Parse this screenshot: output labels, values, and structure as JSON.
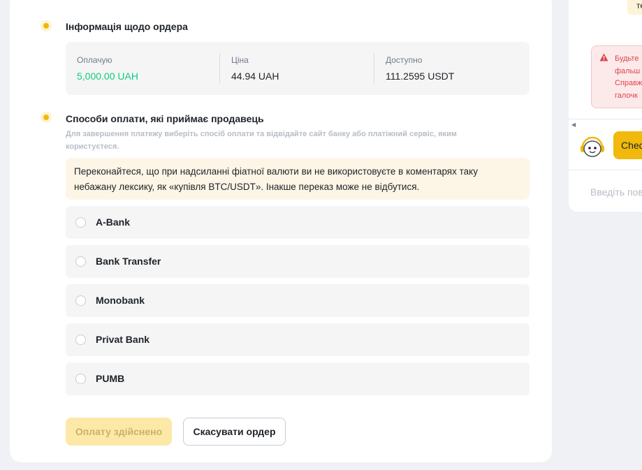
{
  "order_info": {
    "title": "Інформація щодо ордера",
    "items": [
      {
        "label": "Оплачую",
        "value": "5,000.00 UAH"
      },
      {
        "label": "Ціна",
        "value": "44.94 UAH"
      },
      {
        "label": "Доступно",
        "value": "111.2595 USDT"
      }
    ]
  },
  "payment_methods": {
    "title": "Способи оплати, які приймає продавець",
    "hint": "Для завершення платежу виберіть спосіб оплати та відвідайте сайт банку або платіжний сервіс, яким користуєтеся.",
    "warning": "Переконайтеся, що при надсиланні фіатної валюти ви не використовуєте в коментарях таку небажану лексику, як «купівля BTC/USDT». Інакше переказ може не відбутися.",
    "options": [
      "A-Bank",
      "Bank Transfer",
      "Monobank",
      "Privat Bank",
      "PUMB"
    ]
  },
  "actions": {
    "paid_label": "Оплату здійснено",
    "cancel_label": "Скасувати ордер"
  },
  "chat": {
    "top_bubble_text": "те",
    "alert_lines": [
      "Будьте",
      "фальш",
      "Справж",
      "галочк"
    ],
    "quick_reply": "Chec",
    "input_placeholder": "Введіть пов"
  },
  "colors": {
    "accent": "#f0b90b",
    "positive": "#0ecb81",
    "danger": "#e0424f"
  }
}
